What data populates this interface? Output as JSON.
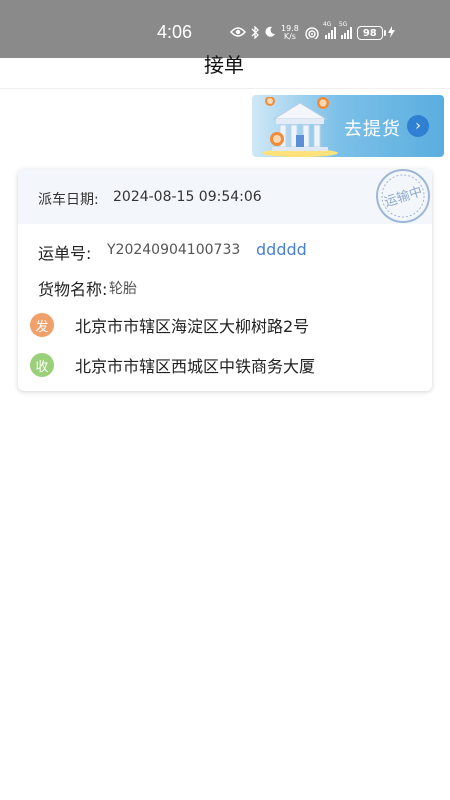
{
  "status_bar": {
    "time": "4:06",
    "net_speed_value": "19.8",
    "net_speed_unit": "K/s",
    "signal_1_tag": "4G",
    "signal_2_tag": "5G",
    "battery": "98"
  },
  "header": {
    "title": "接单"
  },
  "pickup_banner": {
    "label": "去提货"
  },
  "order": {
    "dispatch_label": "派车日期:",
    "dispatch_date": "2024-08-15 09:54:06",
    "stamp_text": "运输中",
    "waybill_label": "运单号:",
    "waybill_number": "Y20240904100733",
    "waybill_extra": "ddddd",
    "goods_label": "货物名称:",
    "goods_value": "轮胎",
    "sender_badge": "发",
    "sender_address": "北京市市辖区海淀区大柳树路2号",
    "receiver_badge": "收",
    "receiver_address": "北京市市辖区西城区中铁商务大厦"
  },
  "colors": {
    "status_bar_bg": "#8a8a8a",
    "accent_blue": "#4a7fd4",
    "sender_orange": "#f0a06a",
    "receiver_green": "#9bd07a",
    "card_header_bg": "#f3f7fb"
  },
  "icons": [
    "eye-icon",
    "bluetooth-icon",
    "moon-icon",
    "wifi-icon",
    "signal-icon",
    "battery-icon",
    "charging-icon",
    "building-icon",
    "chevron-right-icon",
    "stamp-icon"
  ]
}
